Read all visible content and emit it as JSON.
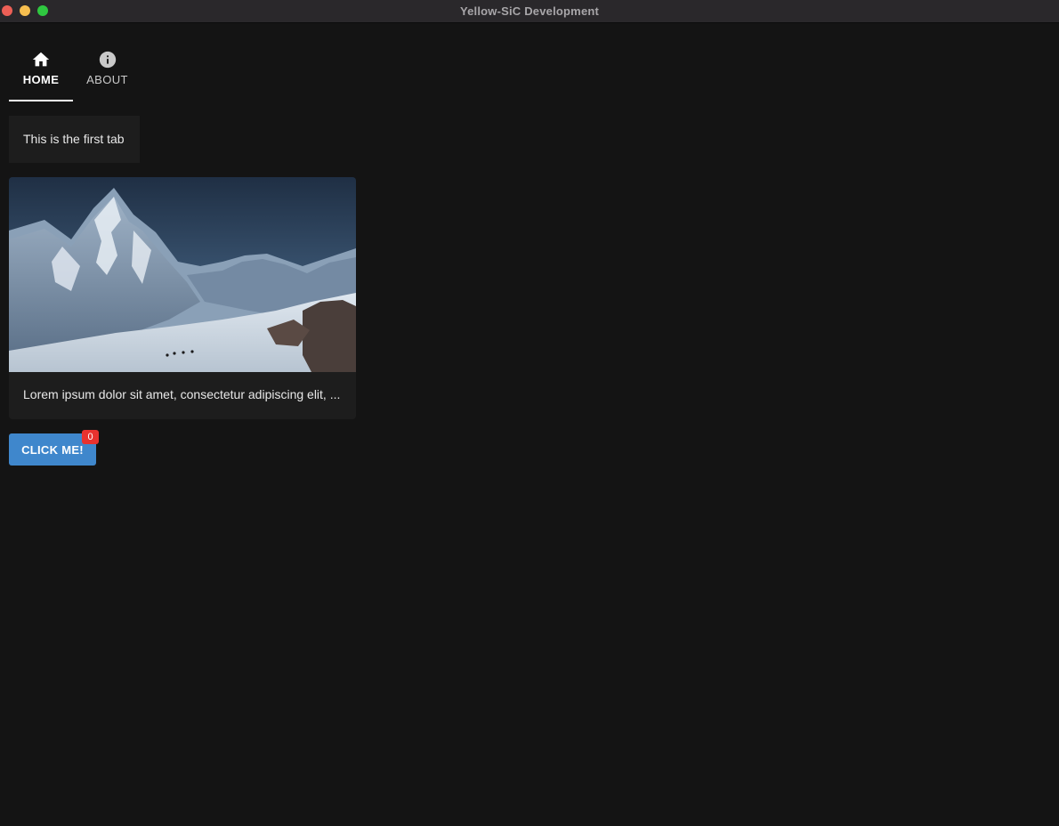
{
  "window": {
    "title": "Yellow-SiC Development"
  },
  "tabs": [
    {
      "label": "HOME",
      "icon": "home-icon",
      "selected": true
    },
    {
      "label": "ABOUT",
      "icon": "info-icon",
      "selected": false
    }
  ],
  "content": {
    "tab_text": "This is the first tab",
    "card": {
      "image": "snowy-mountain-photo",
      "text": "Lorem ipsum dolor sit amet, consectetur adipiscing elit, ..."
    },
    "button": {
      "label": "CLICK ME!",
      "badge_count": "0"
    }
  },
  "colors": {
    "background": "#141414",
    "surface": "#1d1d1d",
    "primary": "#3f87cc",
    "badge": "#e8322f"
  }
}
